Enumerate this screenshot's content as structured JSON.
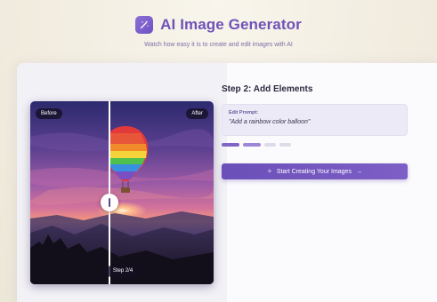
{
  "header": {
    "logo_icon": "magic-wand-icon",
    "title": "AI Image Generator",
    "subtitle": "Watch how easy it is to create and edit images with AI"
  },
  "comparison": {
    "before_label": "Before",
    "after_label": "After",
    "step_indicator": "Step 2/4"
  },
  "step": {
    "title": "Step 2: Add Elements",
    "prompt_label": "Edit Prompt:",
    "prompt_text": "\"Add a rainbow color balloon\"",
    "progress_total": 4,
    "progress_current": 2
  },
  "cta": {
    "icon": "sparkle-icon",
    "label": "Start Creating Your Images",
    "arrow": "→"
  },
  "colors": {
    "brand": "#6f52b8",
    "button": "#6b4fb8"
  }
}
